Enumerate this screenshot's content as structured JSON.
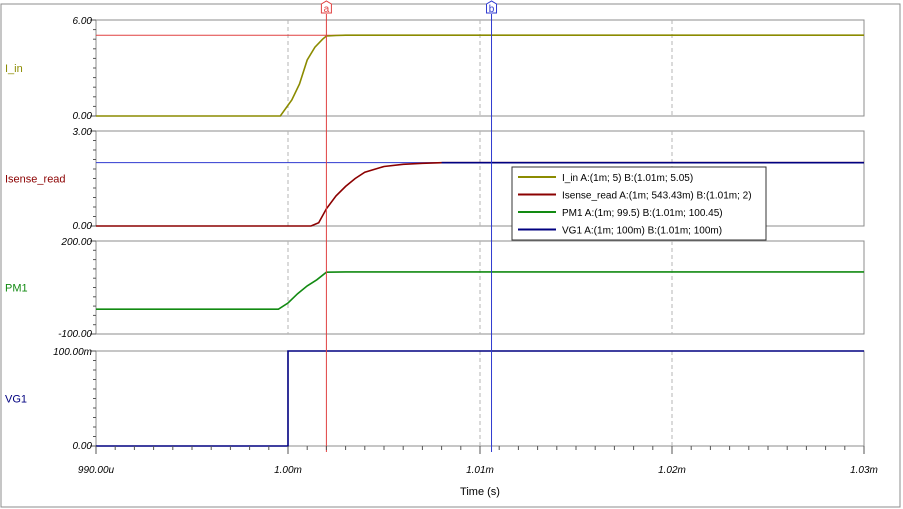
{
  "chart_data": {
    "type": "line",
    "xlabel": "Time (s)",
    "x_ticks": [
      "990.00u",
      "1.00m",
      "1.01m",
      "1.02m",
      "1.03m"
    ],
    "x_range": [
      0.00099,
      0.00103
    ],
    "cursors": [
      {
        "label": "a",
        "x": 0.001002,
        "color": "#e04040"
      },
      {
        "label": "b",
        "x": 0.0010106,
        "color": "#2f3ad0"
      }
    ],
    "panels": [
      {
        "name": "I_in",
        "ymin": 0,
        "ymax": 6,
        "ytick_top": "6.00",
        "ytick_bottom": "0.00",
        "series": [
          {
            "name": "I_in",
            "color": "#8b8b00",
            "points": [
              [
                0.00099,
                0
              ],
              [
                0.0009996,
                0
              ],
              [
                0.0010002,
                1.0
              ],
              [
                0.0010006,
                2.0
              ],
              [
                0.001001,
                3.5
              ],
              [
                0.0010014,
                4.3
              ],
              [
                0.0010018,
                4.8
              ],
              [
                0.001002,
                5.0
              ],
              [
                0.0010025,
                5.03
              ],
              [
                0.001003,
                5.05
              ],
              [
                0.00103,
                5.05
              ]
            ]
          }
        ],
        "hline": 5.05
      },
      {
        "name": "Isense_read",
        "ymin": 0,
        "ymax": 3,
        "ytick_top": "3.00",
        "ytick_bottom": "0.00",
        "series": [
          {
            "name": "Isense_read",
            "color": "#8b0000",
            "points": [
              [
                0.00099,
                0
              ],
              [
                0.0010012,
                0
              ],
              [
                0.0010016,
                0.1
              ],
              [
                0.001002,
                0.543
              ],
              [
                0.0010025,
                0.95
              ],
              [
                0.001003,
                1.25
              ],
              [
                0.0010035,
                1.5
              ],
              [
                0.001004,
                1.7
              ],
              [
                0.001005,
                1.88
              ],
              [
                0.001006,
                1.95
              ],
              [
                0.001007,
                1.98
              ],
              [
                0.001008,
                2.0
              ],
              [
                0.00103,
                2.0
              ]
            ]
          },
          {
            "name": "VG1",
            "color": "#000080",
            "points": [
              [
                0.001008,
                2.0
              ],
              [
                0.00103,
                2.0
              ]
            ]
          }
        ],
        "hline": 2.0
      },
      {
        "name": "PM1",
        "ymin": -100,
        "ymax": 200,
        "ytick_top": "200.00",
        "ytick_bottom": "-100.00",
        "series": [
          {
            "name": "PM1",
            "color": "#128a12",
            "points": [
              [
                0.00099,
                -20
              ],
              [
                0.0009995,
                -20
              ],
              [
                0.001,
                0
              ],
              [
                0.0010005,
                30
              ],
              [
                0.001001,
                55
              ],
              [
                0.0010015,
                75
              ],
              [
                0.001002,
                99.5
              ],
              [
                0.001003,
                100.45
              ],
              [
                0.00103,
                100.45
              ]
            ]
          }
        ]
      },
      {
        "name": "VG1",
        "ymin": 0,
        "ymax": 0.1,
        "ytick_top": "100.00m",
        "ytick_bottom": "0.00",
        "series": [
          {
            "name": "VG1",
            "color": "#000080",
            "points": [
              [
                0.00099,
                0
              ],
              [
                0.001,
                0
              ],
              [
                0.001,
                0.1
              ],
              [
                0.00103,
                0.1
              ]
            ]
          }
        ]
      }
    ],
    "legend": [
      {
        "name": "I_in",
        "text": "I_in  A:(1m; 5) B:(1.01m; 5.05)",
        "color": "#8b8b00"
      },
      {
        "name": "Isense_read",
        "text": "Isense_read  A:(1m; 543.43m) B:(1.01m; 2)",
        "color": "#8b0000"
      },
      {
        "name": "PM1",
        "text": "PM1  A:(1m; 99.5) B:(1.01m; 100.45)",
        "color": "#128a12"
      },
      {
        "name": "VG1",
        "text": "VG1  A:(1m; 100m) B:(1.01m; 100m)",
        "color": "#000080"
      }
    ]
  }
}
